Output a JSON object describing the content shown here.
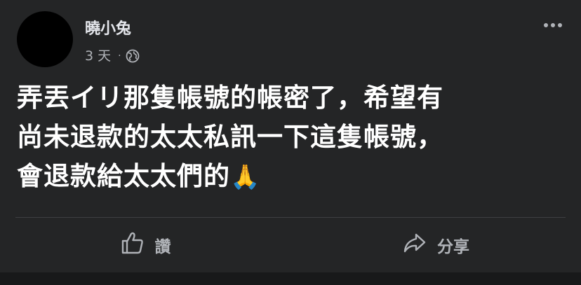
{
  "post": {
    "author": "曉小兔",
    "time": "3 天",
    "separator": "·",
    "privacy_icon": "globe-icon",
    "menu_icon": "more-options-icon",
    "content_lines": [
      "弄丟イリ那隻帳號的帳密了，希望有",
      "尚未退款的太太私訊一下這隻帳號，",
      "會退款給太太們的"
    ],
    "content_emoji": "🙏"
  },
  "actions": {
    "like_label": "讚",
    "like_icon": "thumbs-up-icon",
    "share_label": "分享",
    "share_icon": "share-arrow-icon"
  },
  "colors": {
    "background": "#242526",
    "text": "#e4e6eb",
    "secondary_text": "#b0b3b8",
    "divider": "#3e4042"
  }
}
